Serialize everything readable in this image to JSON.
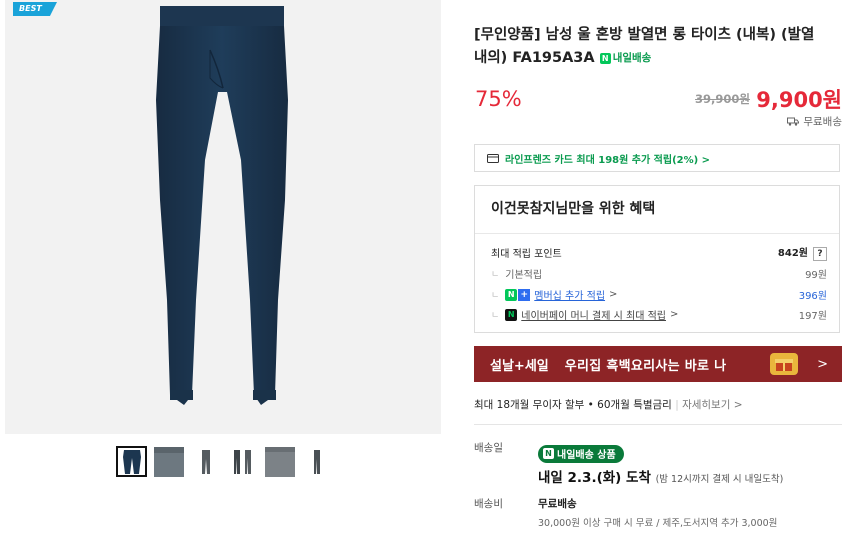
{
  "gallery": {
    "badge": "BEST",
    "thumb_count": 6
  },
  "product": {
    "title_line1": "[무인양품] 남성 울 혼방 발열면 롱 타이츠 (내복) (발열",
    "title_line2": "내의) FA195A3A",
    "delivery_badge": "내일배송",
    "discount_rate": "75%",
    "original_price": "39,900원",
    "price": "9,900원",
    "shipping": "무료배송"
  },
  "card_offer": "라인프렌즈 카드 최대 198원 추가 적립(2%) >",
  "benefit": {
    "title": "이건못참지님만을 위한 혜택",
    "max_label": "최대 적립 포인트",
    "max_value": "842원",
    "help": "?",
    "basic_label": "기본적립",
    "basic_value": "99원",
    "membership_label": "멤버십 추가 적립",
    "membership_value": "396원",
    "pay_label": "네이버페이 머니 결제 시 최대 적립",
    "pay_value": "197원"
  },
  "banner": {
    "tag": "설날+세일",
    "text": "우리집 흑백요리사는 바로 나",
    "arrow": ">"
  },
  "installment": {
    "text": "최대 18개월 무이자 할부 • 60개월 특별금리",
    "more": "자세히보기 >"
  },
  "delivery": {
    "date_label": "배송일",
    "pill": "내일배송 상품",
    "arrival": "내일 2.3.(화) 도착",
    "arrival_note": "(밤 12시까지 결제 시 내일도착)",
    "fee_label": "배송비",
    "fee_value": "무료배송",
    "fee_note": "30,000원 이상 구매 시 무료 / 제주,도서지역 추가 3,000원"
  },
  "colors": {
    "accent_red": "#e52939",
    "naver_green": "#03c75a",
    "banner_bg": "#8d2426",
    "pants_navy": "#1c3650"
  }
}
